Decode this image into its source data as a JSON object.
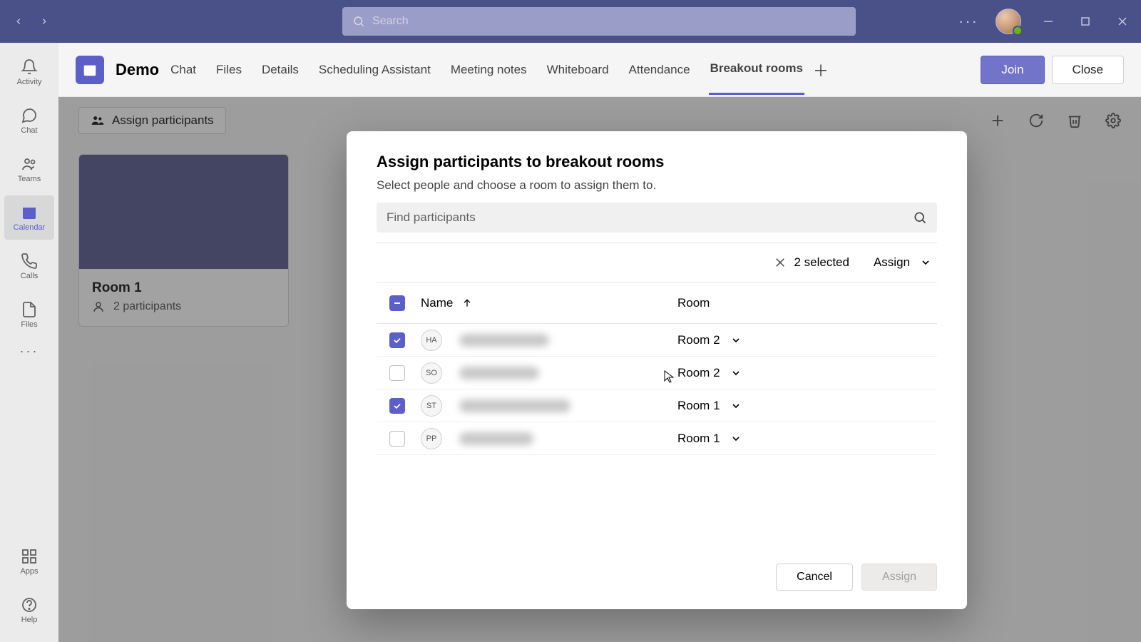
{
  "titlebar": {
    "search_placeholder": "Search"
  },
  "rail": {
    "items": [
      {
        "label": "Activity"
      },
      {
        "label": "Chat"
      },
      {
        "label": "Teams"
      },
      {
        "label": "Calendar"
      },
      {
        "label": "Calls"
      },
      {
        "label": "Files"
      }
    ],
    "apps_label": "Apps",
    "help_label": "Help"
  },
  "header": {
    "meeting_title": "Demo",
    "tabs": [
      "Chat",
      "Files",
      "Details",
      "Scheduling Assistant",
      "Meeting notes",
      "Whiteboard",
      "Attendance",
      "Breakout rooms"
    ],
    "active_tab_index": 7,
    "join_label": "Join",
    "close_label": "Close"
  },
  "toolbar": {
    "assign_participants_label": "Assign participants"
  },
  "room_card": {
    "name": "Room 1",
    "participants_text": "2 participants"
  },
  "modal": {
    "title": "Assign participants to breakout rooms",
    "subtitle": "Select people and choose a room to assign them to.",
    "find_placeholder": "Find participants",
    "selected_text": "2 selected",
    "assign_dropdown_label": "Assign",
    "columns": {
      "name": "Name",
      "room": "Room"
    },
    "participants": [
      {
        "initials": "HA",
        "checked": true,
        "room": "Room 2",
        "name_width": 126
      },
      {
        "initials": "SO",
        "checked": false,
        "room": "Room 2",
        "name_width": 112
      },
      {
        "initials": "ST",
        "checked": true,
        "room": "Room 1",
        "name_width": 156
      },
      {
        "initials": "PP",
        "checked": false,
        "room": "Room 1",
        "name_width": 104
      }
    ],
    "cancel_label": "Cancel",
    "assign_label": "Assign"
  }
}
